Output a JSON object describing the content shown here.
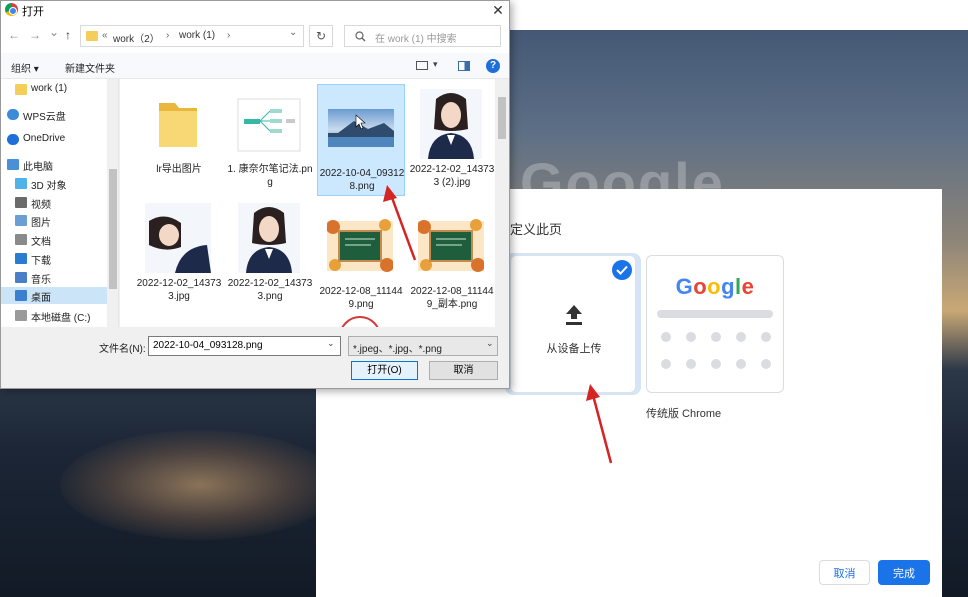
{
  "background": {
    "logo_text": "Google"
  },
  "customize_dialog": {
    "title": "定义此页",
    "upload_label": "从设备上传",
    "classic_logo_letters": [
      "G",
      "o",
      "o",
      "g",
      "l",
      "e"
    ],
    "classic_logo_colors": [
      "#4285f4",
      "#ea4335",
      "#fbbc05",
      "#4285f4",
      "#34a853",
      "#ea4335"
    ],
    "classic_label": "传统版 Chrome",
    "cancel_label": "取消",
    "done_label": "完成",
    "accent_color": "#1a73e8"
  },
  "open_dialog": {
    "title": "打开",
    "close_glyph": "✕",
    "nav": {
      "back": "←",
      "forward": "→",
      "recent": "⌄",
      "up": "↑"
    },
    "address": {
      "prefix": "«",
      "crumbs": [
        "work（2）",
        "work (1)"
      ],
      "separator": "›",
      "dropdown": "⌄",
      "refresh": "↻"
    },
    "search_placeholder": "在 work (1) 中搜索",
    "toolbar": {
      "organize": "组织 ▾",
      "new_folder": "新建文件夹",
      "view_dropdown": "▾",
      "help": "?"
    },
    "sidebar": {
      "items": [
        {
          "label": "work (1)",
          "icon": "folder-icon"
        },
        {
          "label": "WPS云盘",
          "icon": "cloud-icon"
        },
        {
          "label": "OneDrive",
          "icon": "onedrive-icon"
        },
        {
          "label": "此电脑",
          "icon": "computer-icon"
        },
        {
          "label": "3D 对象",
          "icon": "3d-objects-icon"
        },
        {
          "label": "视频",
          "icon": "video-icon"
        },
        {
          "label": "图片",
          "icon": "pictures-icon"
        },
        {
          "label": "文档",
          "icon": "documents-icon"
        },
        {
          "label": "下载",
          "icon": "download-icon"
        },
        {
          "label": "音乐",
          "icon": "music-icon"
        },
        {
          "label": "桌面",
          "icon": "desktop-icon",
          "selected": true
        },
        {
          "label": "本地磁盘 (C:)",
          "icon": "disk-icon"
        }
      ]
    },
    "files": [
      {
        "name": "lr导出图片",
        "kind": "folder"
      },
      {
        "name": "1. 康奈尔笔记法.png",
        "kind": "mindmap"
      },
      {
        "name": "2022-10-04_093128.png",
        "kind": "landscape",
        "selected": true
      },
      {
        "name": "2022-12-02_143733 (2).jpg",
        "kind": "portrait"
      },
      {
        "name": "2022-12-02_143733.jpg",
        "kind": "portrait-side"
      },
      {
        "name": "2022-12-02_143733.png",
        "kind": "portrait"
      },
      {
        "name": "2022-12-08_111449.png",
        "kind": "chalkboard"
      },
      {
        "name": "2022-12-08_111449_副本.png",
        "kind": "chalkboard"
      },
      {
        "name": "",
        "kind": "stamp"
      }
    ],
    "filename_label": "文件名(N):",
    "filename_value": "2022-10-04_093128.png",
    "filetype_value": "*.jpeg、*.jpg、*.png",
    "open_label": "打开(O)",
    "cancel_label": "取消"
  }
}
